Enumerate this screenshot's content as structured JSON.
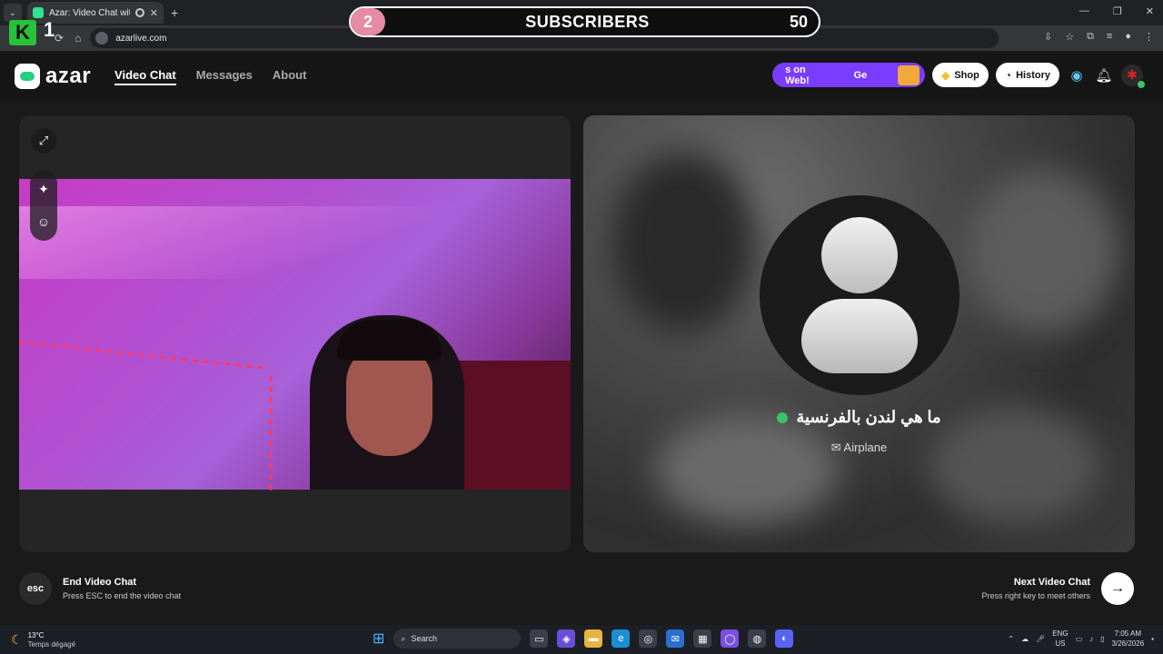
{
  "browser": {
    "tab_title": "Azar: Video Chat with New",
    "new_tab_icon": "plus-icon",
    "url": "azarlive.com",
    "window_controls": [
      "—",
      "❐",
      "✕"
    ]
  },
  "overlay": {
    "k_letter": "K",
    "k_number": "1",
    "subscribers_left": "2",
    "subscribers_label": "SUBSCRIBERS",
    "subscribers_right": "50"
  },
  "azar": {
    "logo_text": "azar",
    "nav": {
      "video_chat": "Video Chat",
      "messages": "Messages",
      "about": "About"
    },
    "promo_text": "s on Web!",
    "promo_text_2": "Ge",
    "shop_label": "Shop",
    "history_label": "History"
  },
  "peer": {
    "name": "ما هي لندن بالفرنسية",
    "status_icon": "✉",
    "status": "Airplane"
  },
  "controls": {
    "esc_label": "esc",
    "end_title": "End Video Chat",
    "end_sub": "Press ESC to end the video chat",
    "next_title": "Next Video Chat",
    "next_sub": "Press right key to meet others",
    "next_arrow": "→"
  },
  "taskbar": {
    "temperature": "13°C",
    "weather": "Temps dégagé",
    "search_placeholder": "Search",
    "lang_1": "ENG",
    "lang_2": "US",
    "time": "7:05 AM",
    "date": "3/26/2026"
  },
  "colors": {
    "accent_green": "#25d07f",
    "promo_purple": "#7a3cff",
    "subscriber_pink": "#e58ba4"
  }
}
